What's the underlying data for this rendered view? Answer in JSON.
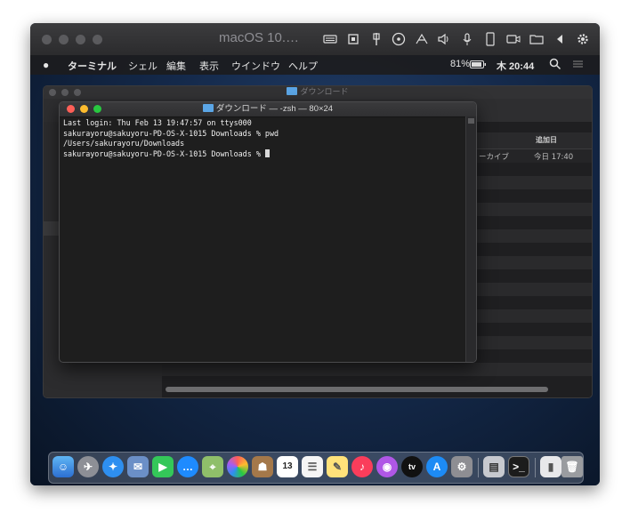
{
  "vm": {
    "title": "macOS 10.…"
  },
  "menubar": {
    "app": "ターミナル",
    "items": [
      "シェル",
      "編集",
      "表示",
      "ウインドウ",
      "ヘルプ"
    ],
    "battery": "81%",
    "clock": "木 20:44"
  },
  "finder": {
    "title": "ダウンロード",
    "column_header": "追加日",
    "row_kind": "ーカイブ",
    "row_date": "今日 17:40"
  },
  "terminal": {
    "title": "ダウンロード — -zsh — 80×24",
    "lines": [
      "Last login: Thu Feb 13 19:47:57 on ttys000",
      "sakurayoru@sakuyoru-PD-OS-X-1015 Downloads % pwd",
      "/Users/sakurayoru/Downloads",
      "sakurayoru@sakuyoru-PD-OS-X-1015 Downloads % "
    ]
  },
  "dock": {
    "calendar_day": "13",
    "tv_label": "tv"
  },
  "colors": {
    "close": "#ff5f57",
    "minimize": "#febc2e",
    "zoom": "#28c840"
  }
}
